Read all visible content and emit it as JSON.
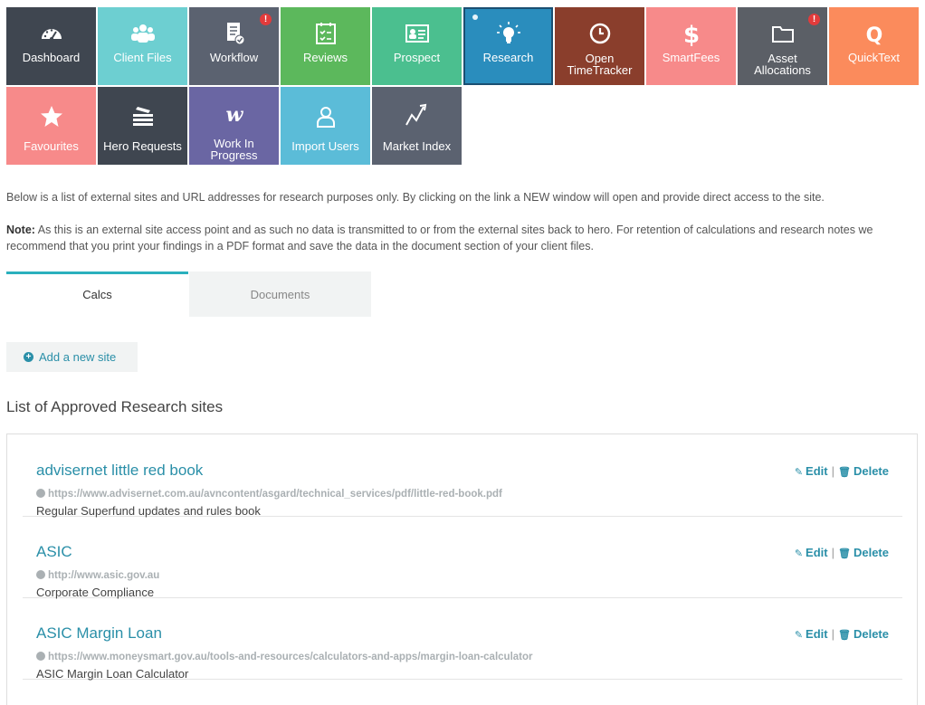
{
  "tiles": [
    {
      "label": "Dashboard",
      "color": "#3f4650",
      "icon": "dashboard-icon"
    },
    {
      "label": "Client Files",
      "color": "#6dcfd1",
      "icon": "users-icon"
    },
    {
      "label": "Workflow",
      "color": "#5b6270",
      "icon": "workflow-icon",
      "badge": "!"
    },
    {
      "label": "Reviews",
      "color": "#5cb85c",
      "icon": "reviews-icon"
    },
    {
      "label": "Prospect",
      "color": "#4bbf8f",
      "icon": "prospect-card-icon"
    },
    {
      "label": "Research",
      "color": "#2a8dbd",
      "icon": "lightbulb-icon"
    },
    {
      "label_line1": "Open",
      "label_line2": "TimeTracker",
      "color": "#8a3e2c",
      "icon": "clock-icon"
    },
    {
      "label": "SmartFees",
      "color": "#f78a8a",
      "icon": "dollar-icon"
    },
    {
      "label_line1": "Asset",
      "label_line2": "Allocations",
      "color": "#5b5f66",
      "icon": "folder-icon",
      "badge": "!"
    },
    {
      "label": "QuickText",
      "color": "#fb8b5c",
      "icon": "q-icon",
      "icon_text": "Q"
    },
    {
      "label": "Favourites",
      "color": "#f78a8a",
      "icon": "star-icon"
    },
    {
      "label": "Hero Requests",
      "color": "#3f4650",
      "icon": "stack-icon"
    },
    {
      "label_line1": "Work In",
      "label_line2": "Progress",
      "color": "#6a66a3",
      "icon": "w-icon",
      "icon_text": "w"
    },
    {
      "label": "Import Users",
      "color": "#5bbcd8",
      "icon": "user-outline-icon"
    },
    {
      "label": "Market Index",
      "color": "#5b6270",
      "icon": "trend-icon"
    }
  ],
  "intro": "Below is a list of external sites and URL addresses for research purposes only. By clicking on the link a NEW window will open and provide direct access to the site.",
  "note": {
    "label": "Note:",
    "text": " As this is an external site access point and as such no data is transmitted to or from the external sites back to hero. For retention of calculations and research notes we recommend that you print your findings in a PDF format and save the data in the document section of your client files."
  },
  "tabs": {
    "calcs": "Calcs",
    "documents": "Documents"
  },
  "add_site": "Add a new site",
  "list_title": "List of Approved Research sites",
  "actions": {
    "edit": "Edit",
    "delete": "Delete"
  },
  "sites": [
    {
      "title": "advisernet little red book",
      "url": "https://www.advisernet.com.au/avncontent/asgard/technical_services/pdf/little-red-book.pdf",
      "desc": "Regular Superfund updates and rules book"
    },
    {
      "title": "ASIC",
      "url": "http://www.asic.gov.au",
      "desc": "Corporate Compliance"
    },
    {
      "title": "ASIC Margin Loan",
      "url": "https://www.moneysmart.gov.au/tools-and-resources/calculators-and-apps/margin-loan-calculator",
      "desc": "ASIC Margin Loan Calculator"
    }
  ]
}
